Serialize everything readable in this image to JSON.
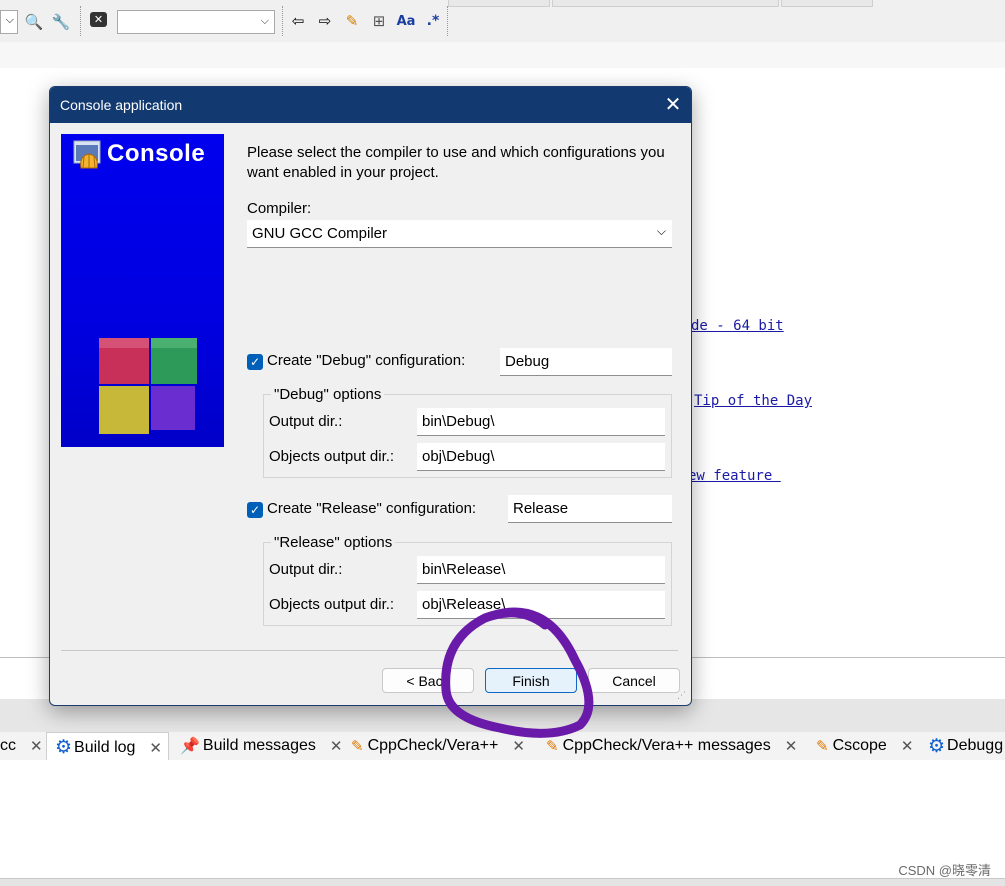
{
  "dialog": {
    "title": "Console application",
    "banner_title": "Console",
    "intro": "Please select the compiler to use and which configurations you want enabled in your project.",
    "compiler_label": "Compiler:",
    "compiler_value": "GNU GCC Compiler",
    "debug": {
      "checkbox_label": "Create \"Debug\" configuration:",
      "checked": true,
      "name": "Debug",
      "group_label": "\"Debug\" options",
      "output_dir_label": "Output dir.:",
      "output_dir": "bin\\Debug\\",
      "obj_dir_label": "Objects output dir.:",
      "obj_dir": "obj\\Debug\\"
    },
    "release": {
      "checkbox_label": "Create \"Release\" configuration:",
      "checked": true,
      "name": "Release",
      "group_label": "\"Release\" options",
      "output_dir_label": "Output dir.:",
      "output_dir": "bin\\Release\\",
      "obj_dir_label": "Objects output dir.:",
      "obj_dir": "obj\\Release\\"
    },
    "buttons": {
      "back": "< Back",
      "finish": "Finish",
      "cancel": "Cancel"
    }
  },
  "editor": {
    "links": [
      "de - 64 bit",
      "Tip of the Day",
      "ew feature "
    ]
  },
  "bottom_tabs": [
    {
      "label": "cc",
      "icon": "partial-tab",
      "close": "✕"
    },
    {
      "label": "Build log",
      "icon": "gear-icon",
      "close": "✕"
    },
    {
      "label": "Build messages",
      "icon": "pin-icon",
      "close": "✕"
    },
    {
      "label": "CppCheck/Vera++",
      "icon": "pencil-page-icon",
      "close": "✕"
    },
    {
      "label": "CppCheck/Vera++ messages",
      "icon": "pencil-page-icon",
      "close": "✕"
    },
    {
      "label": "Cscope",
      "icon": "pencil-page-icon",
      "close": "✕"
    },
    {
      "label": "Debugg",
      "icon": "gear-icon",
      "close": ""
    }
  ],
  "watermark": "CSDN @晓零清",
  "colors": {
    "titlebar": "#123a70",
    "banner": "#0000ee",
    "checkbox": "#005fb8",
    "default_button_border": "#0f68c4",
    "annotation_circle": "#6a1aa8",
    "link": "#1a1aa6"
  }
}
